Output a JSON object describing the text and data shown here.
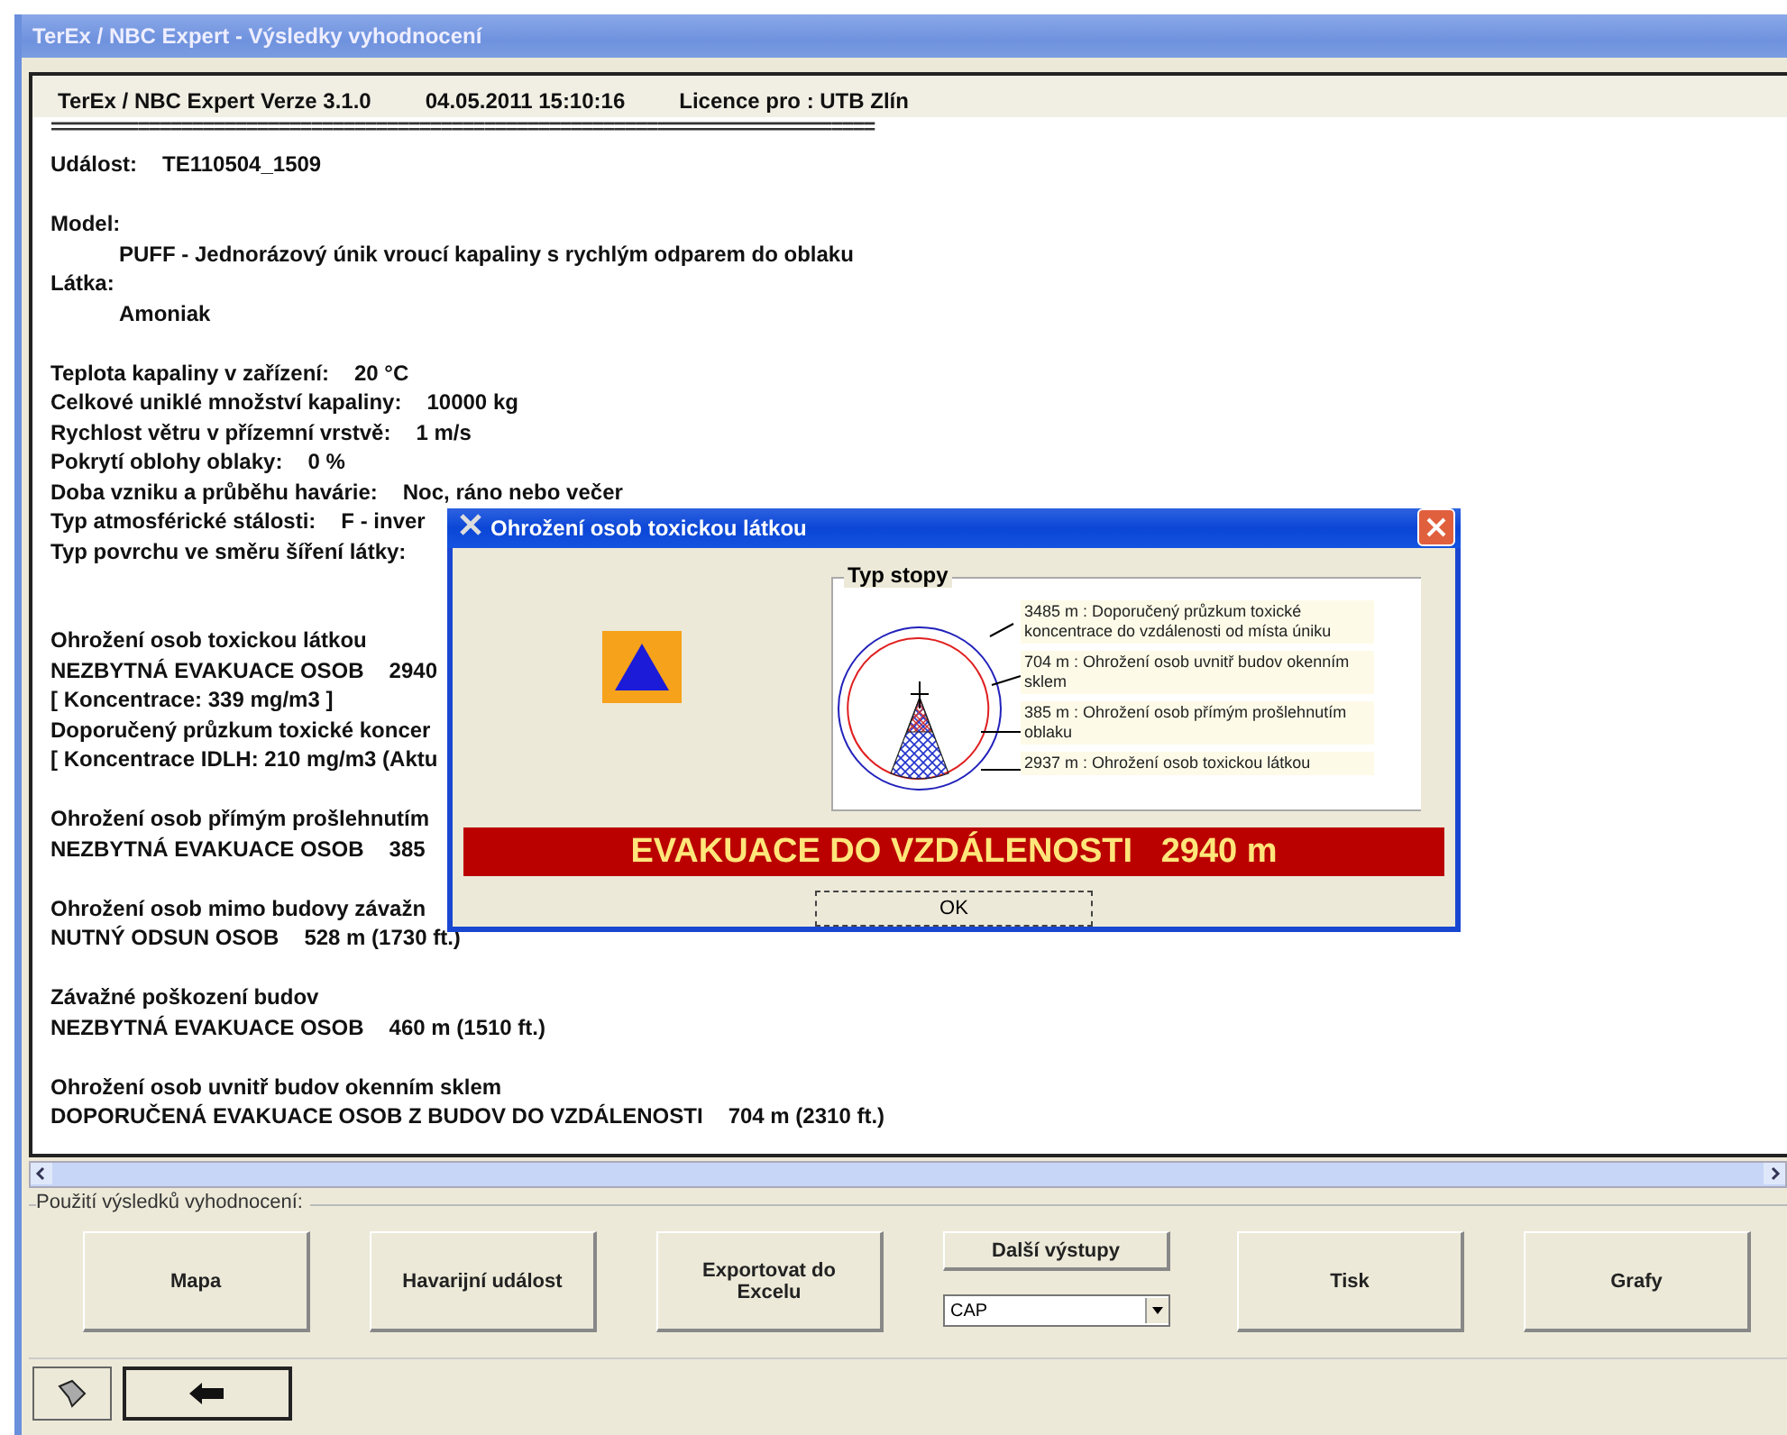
{
  "window": {
    "title": "TerEx / NBC Expert - Výsledky vyhodnocení"
  },
  "report": {
    "header": [
      "TerEx / NBC Expert  Verze 3.1.0",
      "04.05.2011 15:10:16",
      "Licence pro : UTB Zlín"
    ],
    "lines": [
      {
        "kind": "rule",
        "parts": [
          "============================================================================"
        ]
      },
      {
        "kind": "text",
        "parts": [
          "Událost:",
          "TE110504_1509"
        ]
      },
      {
        "kind": "blank"
      },
      {
        "kind": "text",
        "parts": [
          "Model:"
        ]
      },
      {
        "kind": "indent",
        "parts": [
          "PUFF - Jednorázový únik vroucí kapaliny s rychlým odparem do oblaku"
        ]
      },
      {
        "kind": "text",
        "parts": [
          "Látka:"
        ]
      },
      {
        "kind": "indent",
        "parts": [
          "Amoniak"
        ]
      },
      {
        "kind": "blank"
      },
      {
        "kind": "text",
        "parts": [
          "Teplota kapaliny v zařízení:",
          "20 °C"
        ]
      },
      {
        "kind": "text",
        "parts": [
          "Celkové uniklé množství kapaliny:",
          "10000 kg"
        ]
      },
      {
        "kind": "text",
        "parts": [
          "Rychlost větru v přízemní vrstvě:",
          "1 m/s"
        ]
      },
      {
        "kind": "text",
        "parts": [
          "Pokrytí oblohy oblaky:",
          "0 %"
        ]
      },
      {
        "kind": "text",
        "parts": [
          "Doba vzniku a průběhu havárie:",
          "Noc, ráno nebo večer"
        ]
      },
      {
        "kind": "text",
        "parts": [
          "Typ atmosférické stálosti:",
          "F - inver"
        ]
      },
      {
        "kind": "text",
        "parts": [
          "Typ povrchu ve směru šíření látky:"
        ]
      },
      {
        "kind": "blank"
      },
      {
        "kind": "blank"
      },
      {
        "kind": "text",
        "parts": [
          "Ohrožení osob toxickou látkou"
        ]
      },
      {
        "kind": "text",
        "parts": [
          "NEZBYTNÁ EVAKUACE OSOB",
          "2940"
        ]
      },
      {
        "kind": "text",
        "parts": [
          "[ Koncentrace: 339 mg/m3 ]"
        ]
      },
      {
        "kind": "text",
        "parts": [
          "Doporučený průzkum toxické koncer"
        ]
      },
      {
        "kind": "text",
        "parts": [
          "[ Koncentrace IDLH: 210 mg/m3 (Aktu"
        ]
      },
      {
        "kind": "blank"
      },
      {
        "kind": "text",
        "parts": [
          "Ohrožení osob přímým prošlehnutím"
        ]
      },
      {
        "kind": "text",
        "parts": [
          "NEZBYTNÁ EVAKUACE OSOB",
          "385"
        ]
      },
      {
        "kind": "blank"
      },
      {
        "kind": "text",
        "parts": [
          "Ohrožení osob mimo budovy závažn"
        ]
      },
      {
        "kind": "text",
        "parts": [
          "NUTNÝ ODSUN OSOB",
          "528 m (1730 ft.)"
        ]
      },
      {
        "kind": "blank"
      },
      {
        "kind": "text",
        "parts": [
          "Závažné poškození budov"
        ]
      },
      {
        "kind": "text",
        "parts": [
          "NEZBYTNÁ EVAKUACE OSOB",
          "460 m (1510 ft.)"
        ]
      },
      {
        "kind": "blank"
      },
      {
        "kind": "text",
        "parts": [
          "Ohrožení osob uvnitř budov okenním sklem"
        ]
      },
      {
        "kind": "text",
        "parts": [
          "DOPORUČENÁ EVAKUACE OSOB Z BUDOV DO VZDÁLENOSTI",
          "704 m (2310 ft.)"
        ]
      }
    ]
  },
  "usage": {
    "legend": "Použití výsledků vyhodnocení:",
    "buttons": [
      {
        "kind": "button",
        "label": "Mapa"
      },
      {
        "kind": "button",
        "label": "Havarijní událost"
      },
      {
        "kind": "button",
        "label": "Exportovat do Excelu"
      },
      {
        "kind": "combo",
        "label": "Další výstupy",
        "value": "CAP"
      },
      {
        "kind": "button",
        "label": "Tisk"
      },
      {
        "kind": "button",
        "label": "Grafy"
      }
    ]
  },
  "dialog": {
    "title": "Ohrožení osob toxickou látkou",
    "group_title": "Typ stopy",
    "legend": [
      {
        "text": "3485 m : Doporučený průzkum toxické koncentrace do vzdálenosti od místa úniku"
      },
      {
        "text": "704 m : Ohrožení osob uvnitř budov okenním sklem"
      },
      {
        "text": "385 m : Ohrožení osob přímým prošlehnutím oblaku"
      },
      {
        "text": "2937 m : Ohrožení osob toxickou látkou"
      }
    ],
    "banner": "EVAKUACE DO VZDÁLENOSTI   2940 m",
    "ok": "OK"
  }
}
